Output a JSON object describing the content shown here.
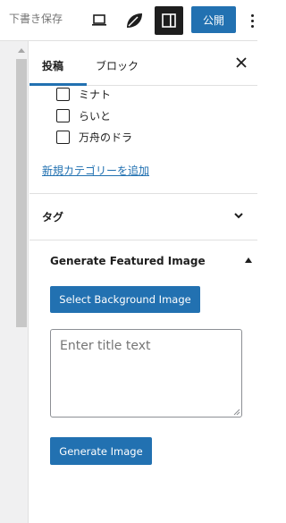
{
  "toolbar": {
    "save_draft": "下書き保存",
    "publish": "公開"
  },
  "sidebar": {
    "tabs": [
      {
        "label": "投稿"
      },
      {
        "label": "ブロック"
      }
    ],
    "categories": [
      {
        "label": "ミナト"
      },
      {
        "label": "らいと"
      },
      {
        "label": "万舟のドラ"
      }
    ],
    "add_category": "新規カテゴリーを追加",
    "tag_panel": "タグ",
    "generate_featured": {
      "title": "Generate Featured Image",
      "select_background": "Select Background Image",
      "title_placeholder": "Enter title text",
      "generate_button": "Generate Image"
    }
  },
  "colors": {
    "accent": "#2271b1",
    "settings_active_bg": "#1e1e1e"
  }
}
